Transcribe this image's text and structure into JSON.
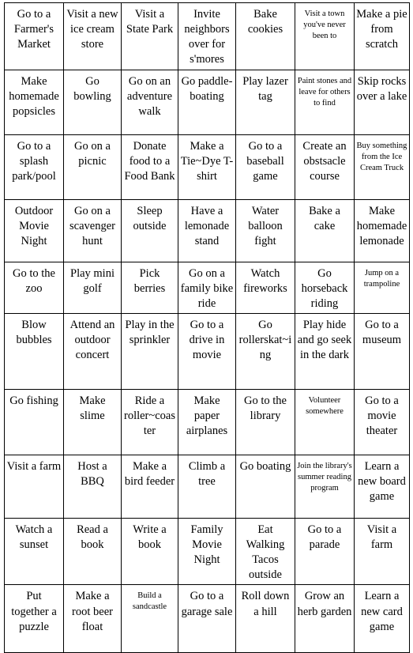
{
  "document": {
    "title": "Summer Activity Bingo Grid",
    "columns": 7,
    "rows": 10,
    "border_color": "#000000",
    "background_color": "#ffffff",
    "text_color": "#000000"
  },
  "grid": {
    "rows": [
      {
        "cells": [
          {
            "text": "Go to a Farmer's Market",
            "size": "normal"
          },
          {
            "text": "Visit a new ice cream store",
            "size": "normal"
          },
          {
            "text": "Visit a State Park",
            "size": "normal"
          },
          {
            "text": "Invite neighbors over for s'mores",
            "size": "normal"
          },
          {
            "text": "Bake cookies",
            "size": "normal"
          },
          {
            "text": "Visit a town you've never been to",
            "size": "small"
          },
          {
            "text": "Make a pie from scratch",
            "size": "normal"
          }
        ]
      },
      {
        "cells": [
          {
            "text": "Make homemade popsicles",
            "size": "normal"
          },
          {
            "text": "Go bowling",
            "size": "normal"
          },
          {
            "text": "Go on an adventure walk",
            "size": "normal"
          },
          {
            "text": "Go paddle-boating",
            "size": "normal"
          },
          {
            "text": "Play lazer tag",
            "size": "normal"
          },
          {
            "text": "Paint stones and leave for others to find",
            "size": "small"
          },
          {
            "text": "Skip rocks over a lake",
            "size": "normal"
          }
        ]
      },
      {
        "cells": [
          {
            "text": "Go to a splash park/pool",
            "size": "normal"
          },
          {
            "text": "Go on a picnic",
            "size": "normal"
          },
          {
            "text": "Donate food to a Food Bank",
            "size": "normal"
          },
          {
            "text": "Make a Tie~Dye T-shirt",
            "size": "normal"
          },
          {
            "text": "Go to a baseball game",
            "size": "normal"
          },
          {
            "text": "Create an obstsacle course",
            "size": "normal"
          },
          {
            "text": "Buy something from the Ice Cream Truck",
            "size": "small"
          }
        ]
      },
      {
        "cells": [
          {
            "text": "Outdoor Movie Night",
            "size": "normal"
          },
          {
            "text": "Go on a scavenger hunt",
            "size": "normal"
          },
          {
            "text": "Sleep outside",
            "size": "normal"
          },
          {
            "text": "Have a lemonade stand",
            "size": "normal"
          },
          {
            "text": "Water balloon fight",
            "size": "normal"
          },
          {
            "text": "Bake a cake",
            "size": "normal"
          },
          {
            "text": "Make homemade lemonade",
            "size": "normal"
          }
        ]
      },
      {
        "cells": [
          {
            "text": "Go to the zoo",
            "size": "normal"
          },
          {
            "text": "Play mini golf",
            "size": "normal"
          },
          {
            "text": "Pick berries",
            "size": "normal"
          },
          {
            "text": "Go on a family bike ride",
            "size": "normal"
          },
          {
            "text": "Watch fireworks",
            "size": "normal"
          },
          {
            "text": "Go horseback riding",
            "size": "normal"
          },
          {
            "text": "Jump on a trampoline",
            "size": "small"
          }
        ]
      },
      {
        "cells": [
          {
            "text": "Blow bubbles",
            "size": "normal"
          },
          {
            "text": "Attend an outdoor concert",
            "size": "normal"
          },
          {
            "text": "Play in the sprinkler",
            "size": "normal"
          },
          {
            "text": "Go to a drive in movie",
            "size": "normal"
          },
          {
            "text": "Go rollerskat~ing",
            "size": "normal"
          },
          {
            "text": "Play hide and go seek in the dark",
            "size": "normal"
          },
          {
            "text": "Go to a museum",
            "size": "normal"
          }
        ]
      },
      {
        "cells": [
          {
            "text": "Go fishing",
            "size": "normal"
          },
          {
            "text": "Make slime",
            "size": "normal"
          },
          {
            "text": "Ride a roller~coaster",
            "size": "normal"
          },
          {
            "text": "Make paper airplanes",
            "size": "normal"
          },
          {
            "text": "Go to the library",
            "size": "normal"
          },
          {
            "text": "Volunteer somewhere",
            "size": "small"
          },
          {
            "text": "Go to a movie theater",
            "size": "normal"
          }
        ]
      },
      {
        "cells": [
          {
            "text": "Visit a farm",
            "size": "normal"
          },
          {
            "text": "Host a BBQ",
            "size": "normal"
          },
          {
            "text": "Make a bird feeder",
            "size": "normal"
          },
          {
            "text": "Climb a tree",
            "size": "normal"
          },
          {
            "text": "Go boating",
            "size": "normal"
          },
          {
            "text": "Join the library's summer reading program",
            "size": "small"
          },
          {
            "text": "Learn a new board game",
            "size": "normal"
          }
        ]
      },
      {
        "cells": [
          {
            "text": "Watch a sunset",
            "size": "normal"
          },
          {
            "text": "Read a book",
            "size": "normal"
          },
          {
            "text": "Write a book",
            "size": "normal"
          },
          {
            "text": "Family Movie Night",
            "size": "normal"
          },
          {
            "text": "Eat Walking Tacos outside",
            "size": "normal"
          },
          {
            "text": "Go to a parade",
            "size": "normal"
          },
          {
            "text": "Visit a farm",
            "size": "normal"
          }
        ]
      },
      {
        "cells": [
          {
            "text": "Put together a puzzle",
            "size": "normal"
          },
          {
            "text": "Make a root beer float",
            "size": "normal"
          },
          {
            "text": "Build a sandcastle",
            "size": "small"
          },
          {
            "text": "Go to a garage sale",
            "size": "normal"
          },
          {
            "text": "Roll down a hill",
            "size": "normal"
          },
          {
            "text": "Grow an herb garden",
            "size": "normal"
          },
          {
            "text": "Learn a new card game",
            "size": "normal"
          }
        ]
      }
    ]
  }
}
